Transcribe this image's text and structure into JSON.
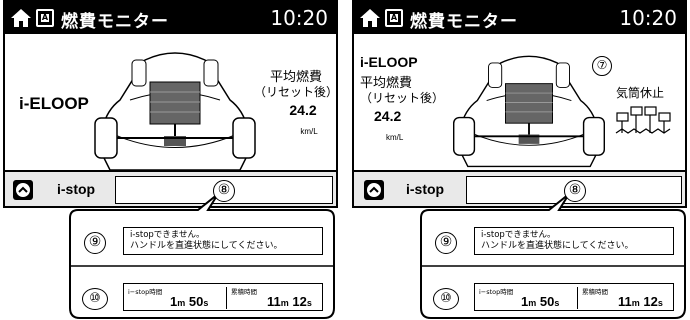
{
  "screens": [
    {
      "title": "燃費モニター",
      "clock": "10:20",
      "eloop": "i-ELOOP",
      "fuel": {
        "line1": "平均燃費",
        "line2": "（リセット後）",
        "value": "24.2",
        "unit": "km/L"
      },
      "istop_label": "i-stop",
      "callout_number": "⑧"
    },
    {
      "title": "燃費モニター",
      "clock": "10:20",
      "eloop": "i-ELOOP",
      "fuel": {
        "line1": "平均燃費",
        "line2": "（リセット後）",
        "value": "24.2",
        "unit": "km/L"
      },
      "cylinder_number": "⑦",
      "cylinder_label": "気筒休止",
      "istop_label": "i-stop",
      "callout_number": "⑧"
    }
  ],
  "callouts": [
    {
      "message_number": "⑨",
      "message_line1": "i-stopできません。",
      "message_line2": "ハンドルを直進状態にしてください。",
      "timer_number": "⑩",
      "istop_time_label": "i−stop時間",
      "istop_min": "1",
      "istop_sec": "50",
      "total_time_label": "累積時間",
      "total_min": "11",
      "total_sec": "12",
      "min_unit": "m",
      "sec_unit": "s"
    },
    {
      "message_number": "⑨",
      "message_line1": "i-stopできません。",
      "message_line2": "ハンドルを直進状態にしてください。",
      "timer_number": "⑩",
      "istop_time_label": "i−stop時間",
      "istop_min": "1",
      "istop_sec": "50",
      "total_time_label": "累積時間",
      "total_min": "11",
      "total_sec": "12",
      "min_unit": "m",
      "sec_unit": "s"
    }
  ]
}
